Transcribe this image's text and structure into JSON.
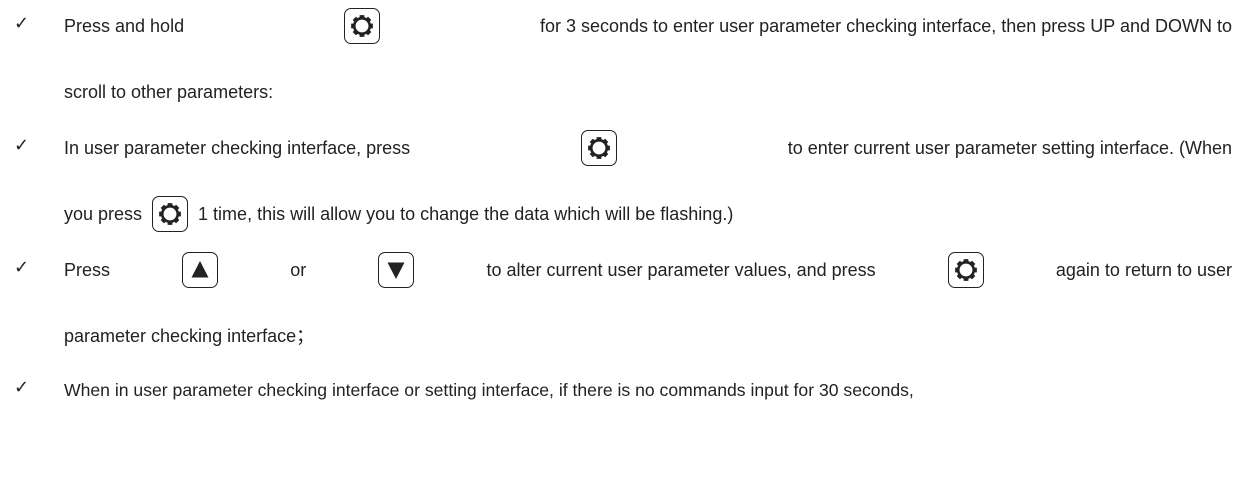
{
  "bullet_icon": "check-mark-icon",
  "key_icons": {
    "set": "gear-icon",
    "up": "up-triangle-icon",
    "down": "down-triangle-icon"
  },
  "items": [
    {
      "line1": {
        "before": "Press and hold",
        "after": "for 3 seconds to enter user parameter checking interface, then press UP and DOWN to"
      },
      "line2": "scroll to other parameters:"
    },
    {
      "line1": {
        "before": "In user parameter checking interface, press",
        "after": "to enter current user parameter setting interface. (When"
      },
      "line2": {
        "before": "you press",
        "after": "1 time, this will allow you to change the data which will be flashing.)"
      }
    },
    {
      "line1": {
        "w1": "Press",
        "w2": "or",
        "w3": "to alter current user parameter values, and press",
        "w4": "again to return to user"
      },
      "line2": "parameter checking interface；"
    },
    {
      "line1": "When in user parameter checking interface or setting interface, if there is no commands input for 30 seconds,"
    }
  ]
}
